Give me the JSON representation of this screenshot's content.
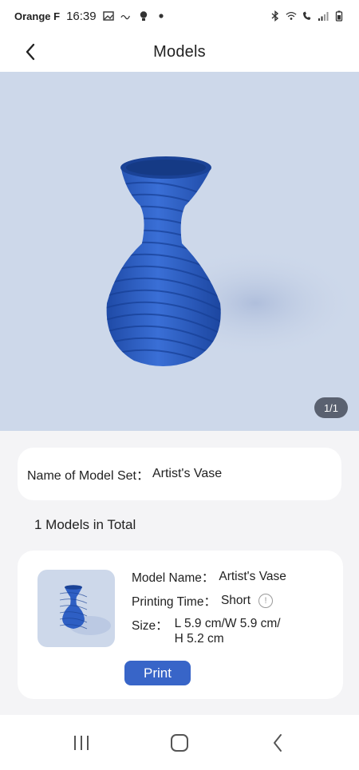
{
  "status": {
    "carrier": "Orange F",
    "time": "16:39",
    "icons_left": [
      "image-icon",
      "wave-icon",
      "bulb-icon",
      "dot-icon"
    ],
    "icons_right": [
      "bluetooth-icon",
      "wifi-icon",
      "wifi-call-icon",
      "signal-icon",
      "battery-icon"
    ]
  },
  "header": {
    "title": "Models"
  },
  "gallery": {
    "counter": "1/1"
  },
  "model_set": {
    "label": "Name of Model Set：",
    "value": "Artist's Vase"
  },
  "total_label": "1 Models in Total",
  "model": {
    "name_label": "Model Name：",
    "name_value": "Artist's Vase",
    "time_label": "Printing Time：",
    "time_value": "Short",
    "size_label": "Size：",
    "size_line1": "L 5.9 cm/W 5.9 cm/",
    "size_line2": "H 5.2 cm",
    "print_label": "Print"
  },
  "colors": {
    "accent": "#3865c8",
    "hero_bg": "#cdd8ea",
    "vase": "#2e5fc4"
  }
}
